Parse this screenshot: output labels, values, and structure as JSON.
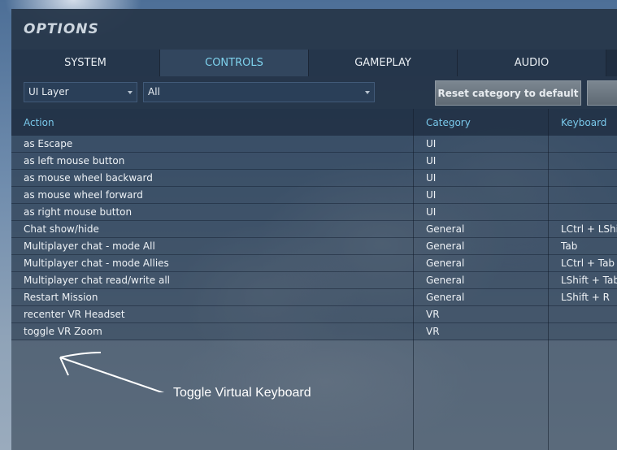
{
  "window": {
    "title": "OPTIONS"
  },
  "tabs": [
    {
      "label": "SYSTEM",
      "active": false
    },
    {
      "label": "CONTROLS",
      "active": true
    },
    {
      "label": "GAMEPLAY",
      "active": false
    },
    {
      "label": "AUDIO",
      "active": false
    }
  ],
  "filters": {
    "layer": "UI Layer",
    "category": "All",
    "reset_label": "Reset category to default"
  },
  "table": {
    "headers": {
      "action": "Action",
      "category": "Category",
      "keyboard": "Keyboard"
    },
    "rows": [
      {
        "action": "as Escape",
        "category": "UI",
        "keyboard": ""
      },
      {
        "action": "as left mouse button",
        "category": "UI",
        "keyboard": ""
      },
      {
        "action": "as mouse wheel backward",
        "category": "UI",
        "keyboard": ""
      },
      {
        "action": "as mouse wheel forward",
        "category": "UI",
        "keyboard": ""
      },
      {
        "action": "as right mouse button",
        "category": "UI",
        "keyboard": ""
      },
      {
        "action": "Chat show/hide",
        "category": "General",
        "keyboard": "LCtrl + LShi"
      },
      {
        "action": "Multiplayer chat - mode All",
        "category": "General",
        "keyboard": "Tab"
      },
      {
        "action": "Multiplayer chat - mode Allies",
        "category": "General",
        "keyboard": "LCtrl + Tab"
      },
      {
        "action": "Multiplayer chat read/write all",
        "category": "General",
        "keyboard": "LShift + Tab"
      },
      {
        "action": "Restart Mission",
        "category": "General",
        "keyboard": "LShift + R"
      },
      {
        "action": "recenter VR Headset",
        "category": "VR",
        "keyboard": ""
      },
      {
        "action": "toggle VR Zoom",
        "category": "VR",
        "keyboard": ""
      }
    ]
  },
  "annotation": {
    "text": "Toggle Virtual Keyboard"
  }
}
